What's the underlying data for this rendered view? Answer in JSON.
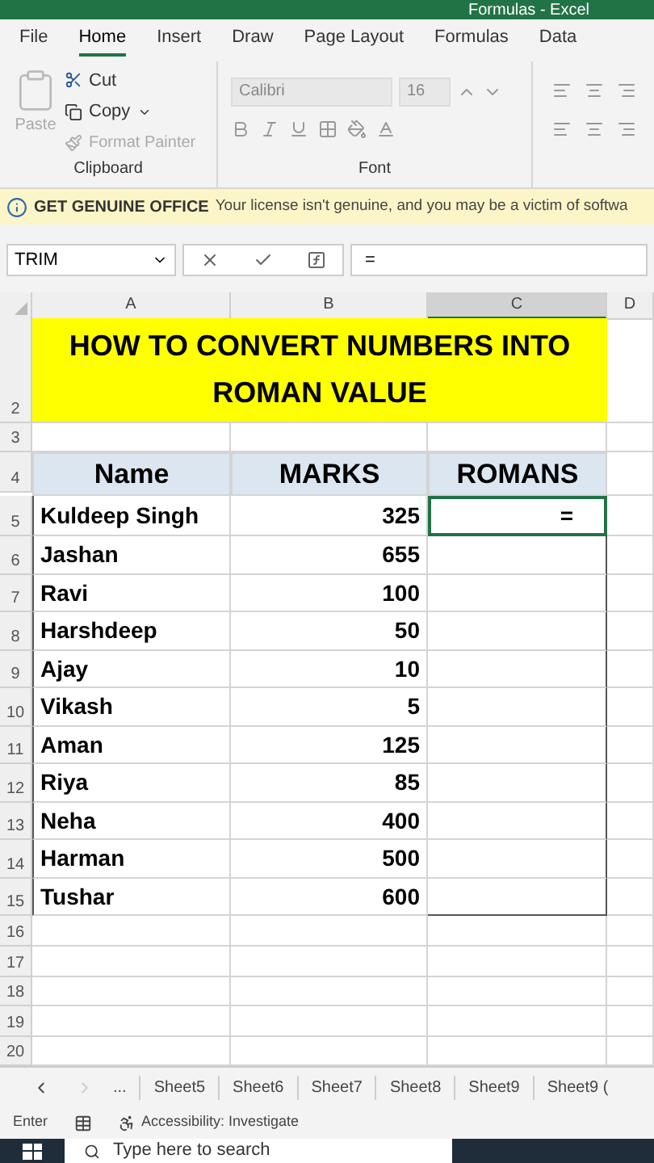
{
  "window": {
    "title": "Formulas - Excel"
  },
  "ribbon_tabs": [
    {
      "label": "File",
      "selected": false
    },
    {
      "label": "Home",
      "selected": true
    },
    {
      "label": "Insert",
      "selected": false
    },
    {
      "label": "Draw",
      "selected": false
    },
    {
      "label": "Page Layout",
      "selected": false
    },
    {
      "label": "Formulas",
      "selected": false
    },
    {
      "label": "Data",
      "selected": false
    }
  ],
  "clipboard": {
    "paste": "Paste",
    "cut": "Cut",
    "copy": "Copy",
    "format_painter": "Format Painter",
    "label": "Clipboard"
  },
  "font": {
    "font_name": "Calibri",
    "font_size": "16",
    "label": "Font"
  },
  "info_bar": {
    "title": "GET GENUINE OFFICE",
    "message": "Your license isn't genuine, and you may be a victim of softwa"
  },
  "formula_bar": {
    "name_box": "TRIM",
    "formula": "="
  },
  "columns": [
    {
      "label": "A",
      "selected": false
    },
    {
      "label": "B",
      "selected": false
    },
    {
      "label": "C",
      "selected": true
    },
    {
      "label": "D",
      "selected": false
    }
  ],
  "sheet": {
    "title_row": "2",
    "title": "HOW TO  CONVERT NUMBERS INTO ROMAN VALUE",
    "blank_row": "3",
    "header_row": "4",
    "headers": [
      "Name",
      "MARKS",
      "ROMANS"
    ],
    "rows": [
      {
        "row": "5",
        "name": "Kuldeep Singh",
        "marks": "325",
        "roman": "=",
        "selected": true
      },
      {
        "row": "6",
        "name": "Jashan",
        "marks": "655",
        "selected": false
      },
      {
        "row": "7",
        "name": "Ravi",
        "marks": "100",
        "selected": false
      },
      {
        "row": "8",
        "name": "Harshdeep",
        "marks": "50",
        "selected": false
      },
      {
        "row": "9",
        "name": "Ajay",
        "marks": "10",
        "selected": false
      },
      {
        "row": "10",
        "name": "Vikash",
        "marks": "5",
        "selected": false
      },
      {
        "row": "11",
        "name": "Aman",
        "marks": "125",
        "selected": false
      },
      {
        "row": "12",
        "name": "Riya",
        "marks": "85",
        "selected": false
      },
      {
        "row": "13",
        "name": "Neha",
        "marks": "400",
        "selected": false
      },
      {
        "row": "14",
        "name": "Harman",
        "marks": "500",
        "selected": false
      },
      {
        "row": "15",
        "name": "Tushar",
        "marks": "600",
        "selected": false
      }
    ],
    "empty_rows": [
      "16",
      "17",
      "18",
      "19",
      "20"
    ]
  },
  "sheet_tabs": [
    "...",
    "Sheet5",
    "Sheet6",
    "Sheet7",
    "Sheet8",
    "Sheet9",
    "Sheet9 ("
  ],
  "status_bar": {
    "mode": "Enter",
    "accessibility": "Accessibility: Investigate"
  },
  "taskbar": {
    "search_placeholder": "Type here to search"
  }
}
